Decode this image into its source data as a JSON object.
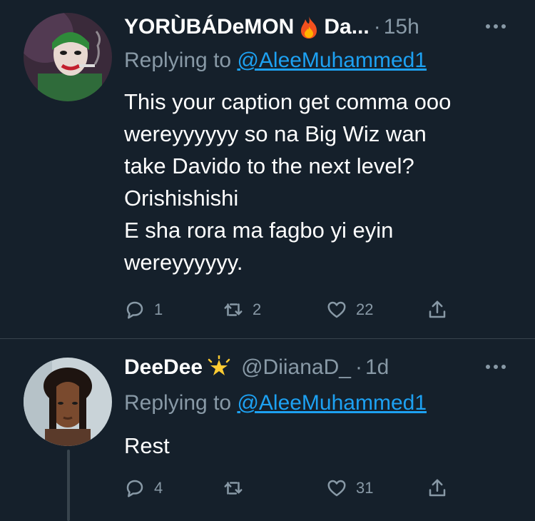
{
  "tweets": [
    {
      "name": "YORÙBÁDeMON",
      "name_suffix": "Da...",
      "handle": "",
      "time": "15h",
      "replying_prefix": "Replying to",
      "replying_mention": "@AleeMuhammed1",
      "text_lines": [
        "This your caption get comma ooo",
        "wereyyyyyy so na Big Wiz wan",
        "take Davido to the next level?",
        "Orishishishi",
        "E sha rora ma fagbo yi eyin",
        "wereyyyyyy."
      ],
      "emoji_icon": "fire-icon",
      "actions": {
        "replies": "1",
        "retweets": "2",
        "likes": "22"
      }
    },
    {
      "name": "DeeDee",
      "handle": "@DiianaD_",
      "time": "1d",
      "replying_prefix": "Replying to",
      "replying_mention": "@AleeMuhammed1",
      "text_lines": [
        "Rest"
      ],
      "emoji_icon": "sparkle-star-icon",
      "actions": {
        "replies": "4",
        "retweets": "",
        "likes": "31"
      }
    }
  ],
  "colors": {
    "background": "#15202b",
    "text": "#ffffff",
    "secondary": "#8899a6",
    "link": "#1da1f2",
    "divider": "#38444d"
  }
}
